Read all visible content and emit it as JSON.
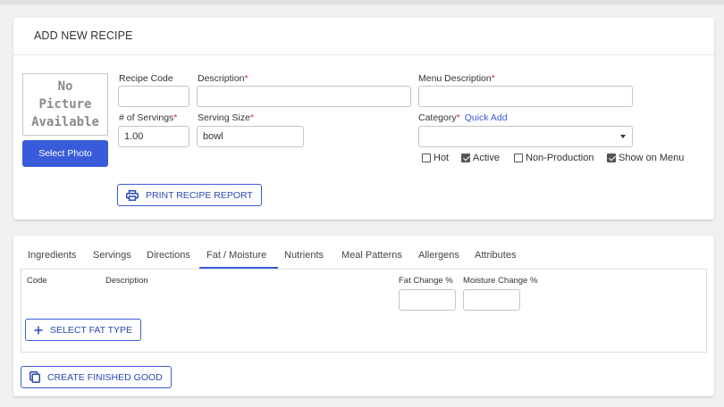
{
  "recipe": {
    "title": "ADD NEW RECIPE",
    "photo": {
      "placeholder_lines": [
        "No",
        "Picture",
        "Available"
      ],
      "select_label": "Select Photo"
    },
    "fields": {
      "recipe_code": {
        "label": "Recipe Code",
        "value": ""
      },
      "description": {
        "label": "Description",
        "required": "*",
        "value": ""
      },
      "menu_description": {
        "label": "Menu Description",
        "required": "*",
        "value": ""
      },
      "servings": {
        "label": "# of Servings",
        "required": "*",
        "value": "1.00"
      },
      "serving_size": {
        "label": "Serving Size",
        "required": "*",
        "value": "bowl"
      },
      "category": {
        "label": "Category",
        "required": "*",
        "quick_add": "Quick Add",
        "value": ""
      }
    },
    "flags": [
      {
        "label": "Hot",
        "checked": false
      },
      {
        "label": "Active",
        "checked": true
      },
      {
        "label": "Non-Production",
        "checked": false
      },
      {
        "label": "Show on Menu",
        "checked": true
      }
    ],
    "print_report_label": "PRINT RECIPE REPORT"
  },
  "tabs": {
    "items": [
      "Ingredients",
      "Servings",
      "Directions",
      "Fat / Moisture",
      "Nutrients",
      "Meal Patterns",
      "Allergens",
      "Attributes"
    ],
    "active": "Fat / Moisture"
  },
  "fat_moisture": {
    "columns": {
      "code": "Code",
      "description": "Description",
      "fat_change": "Fat Change %",
      "moisture_change": "Moisture Change %"
    },
    "fat_change_value": "",
    "moisture_change_value": "",
    "select_fat_type_label": "SELECT FAT TYPE"
  },
  "create_finished_good_label": "CREATE FINISHED GOOD",
  "icons": {
    "printer": "printer-icon",
    "plus": "plus-icon",
    "copy": "copy-icon",
    "dropdown": "caret-down-icon"
  },
  "colors": {
    "accent": "#3a5bd9",
    "required": "#d32f2f",
    "background": "#f0f0f0"
  }
}
